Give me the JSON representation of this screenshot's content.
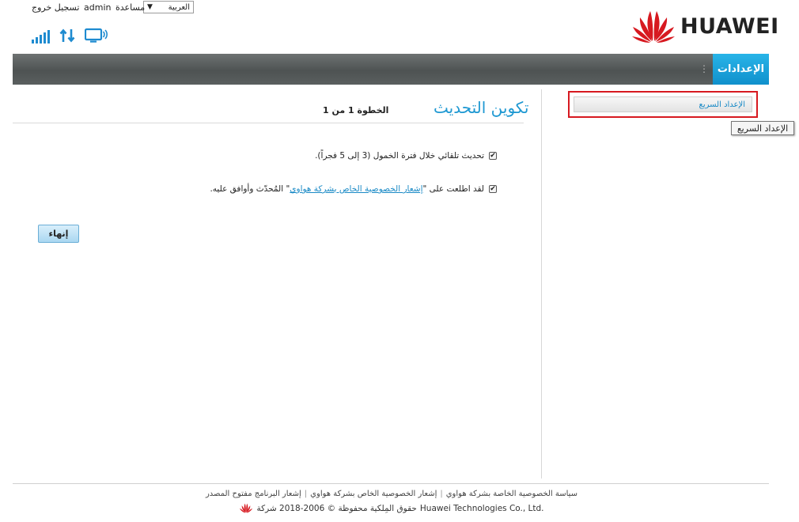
{
  "header": {
    "language_value": "العربية",
    "help": "مساعدة",
    "user": "admin",
    "logout": "تسجيل خروج"
  },
  "brand": {
    "name": "HUAWEI",
    "accent": "#d71920"
  },
  "nav": {
    "settings_tab": "الإعدادات",
    "dots": "⋮",
    "active_color": "#1e98d2"
  },
  "sidebar": {
    "items": [
      {
        "label": "الإعداد السريع",
        "tooltip": "الإعداد السريع"
      }
    ]
  },
  "main": {
    "title": "تكوين التحديث",
    "step": "الخطوة 1 من 1",
    "options": [
      {
        "text": "تحديث تلقائي خلال فترة الخمول (3 إلى 5 فجراً).",
        "checked": true
      },
      {
        "prefix": "لقد اطلعت على \"",
        "link": "إشعار الخصوصية الخاص بشركة هواوي",
        "suffix": "\" المُحدّث وأوافق عليه.",
        "checked": true
      }
    ],
    "finish_button": "إنهاء"
  },
  "footer": {
    "links": [
      "سياسة الخصوصية الخاصة بشركة هواوي",
      "إشعار الخصوصية الخاص بشركة هواوي",
      "إشعار البرنامج مفتوح المصدر"
    ],
    "copyright_company": "Huawei Technologies Co., Ltd.",
    "copyright_text": "حقوق المِلكية محفوظة © 2006-2018 شركة"
  }
}
